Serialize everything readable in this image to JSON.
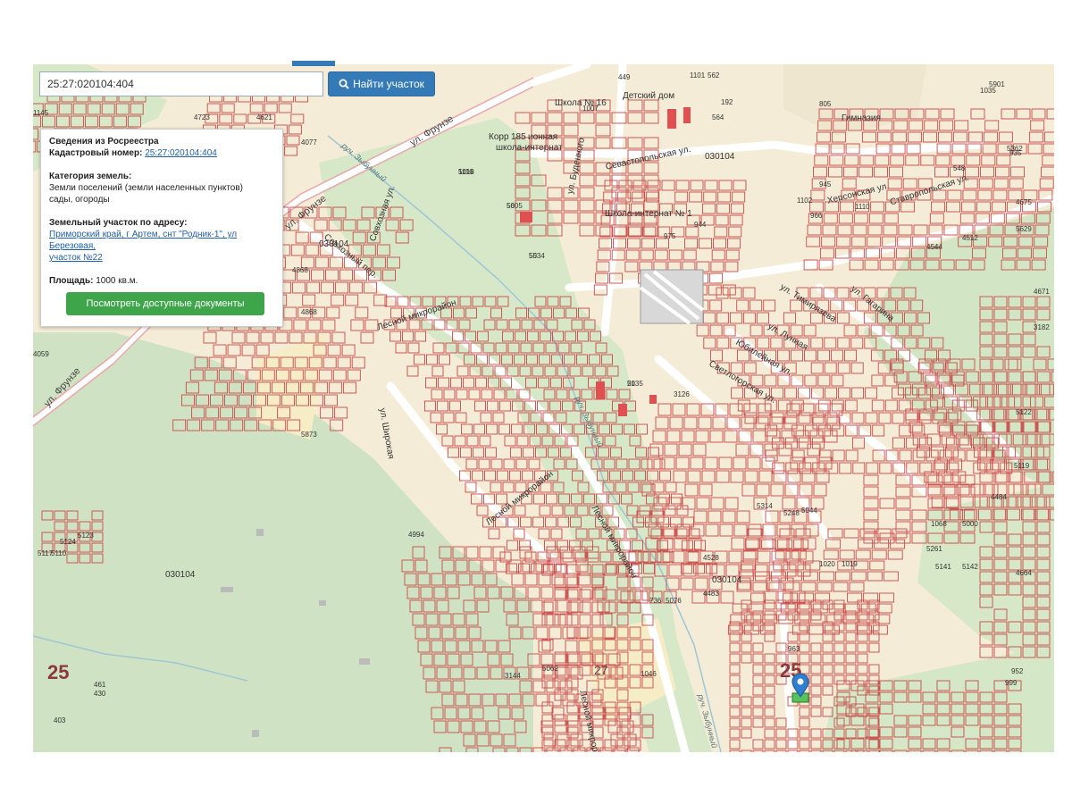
{
  "search": {
    "value": "25:27:020104:404",
    "button_label": "Найти участок"
  },
  "info_panel": {
    "title": "Сведения из Росреестра",
    "cadastral_label": "Кадастровый номер:",
    "cadastral_number": "25:27:020104:404",
    "category_label": "Категория земель:",
    "category_value": "Земли поселений (земли населенных пунктов)",
    "use_value": "сады, огороды",
    "address_label": "Земельный участок по адресу:",
    "address_line1": "Приморский край, г Артем, снт \"Родник-1\", ул Березовая,",
    "address_line2": "участок №22",
    "area_label": "Площадь:",
    "area_value": "1000 кв.м.",
    "docs_button": "Посмотреть доступные документы"
  },
  "map": {
    "streets": {
      "frunze_1": "ул. Фрунзе",
      "frunze_2": "ул. Фрунзе",
      "frunze_3": "ул. Фрунзе",
      "sovkhoznaya": "Совхозная ул.",
      "sovkhozny": "Совхозный пер.",
      "lesnoy_1": "Лесной микрорайон",
      "lesnoy_2": "Лесной микрорайон",
      "lesnoy_3": "Лесной микрорайон",
      "lesnoy_4": "Лесной микрорайон",
      "shirokaya": "ул. Широкая",
      "budennogo": "ул. Буденного",
      "sevastopolskaya": "Севастопольская ул.",
      "khersonskaya": "Херсонская ул.",
      "stavropolskaya": "Ставропольская ул.",
      "timiryazeva": "ул. Тимирязева",
      "lunnaya": "ул. Лунная",
      "yubileynaya": "Юбилейная ул.",
      "svetlogorskaya": "Светлогорская ул.",
      "gagarina": "ул. Гагарина"
    },
    "streams": {
      "zybunny_1": "руч. Зыбунный",
      "zybunny_2": "руч. Зыбунный",
      "zybunny_3": "руч. Зыбунный"
    },
    "pois": {
      "school16": "Школа № 16",
      "detsky_dom": "Детский дом",
      "gymnasium": "Гимназия",
      "korr": "Корр",
      "internat_num": "185",
      "ionnaya": "ионная",
      "internat": "школа-интернат",
      "school_internat": "Школа-интернат № 1"
    },
    "quarters": {
      "q1": "030104",
      "q2": "030104",
      "q3": "030104",
      "q4": "030104"
    },
    "big_numbers": {
      "n1": "25",
      "n2": "25",
      "n3": "27"
    },
    "parcels": [
      "5018",
      "5005",
      "5034",
      "5035",
      "4868",
      "4868",
      "4994",
      "5873",
      "4528",
      "4483",
      "5944",
      "5248",
      "5314",
      "5261",
      "5141",
      "5142",
      "4664",
      "4484",
      "5122",
      "5119",
      "4621",
      "4723",
      "4077",
      "1145",
      "4059",
      "5117",
      "5110",
      "5124",
      "5123",
      "5000",
      "736",
      "5076",
      "5062",
      "3144",
      "1020",
      "1019",
      "1068",
      "3126",
      "1046",
      "4544",
      "4512",
      "5629",
      "5362",
      "4675",
      "4671",
      "3182",
      "5901",
      "1035",
      "1007",
      "1101",
      "449",
      "562",
      "192",
      "564",
      "1110",
      "1102",
      "966",
      "945",
      "944",
      "975",
      "935",
      "548",
      "805",
      "952",
      "999",
      "963",
      "461",
      "430",
      "403",
      "1116",
      "56",
      "55",
      "21"
    ]
  }
}
